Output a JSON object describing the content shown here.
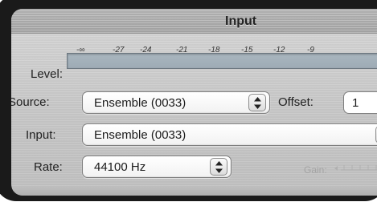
{
  "header": {
    "title": "Input"
  },
  "level": {
    "label": "Level:",
    "ticks": [
      "-∞",
      "-27",
      "-24",
      "-21",
      "-18",
      "-15",
      "-12",
      "-9"
    ]
  },
  "source": {
    "label": "Source:",
    "value": "Ensemble (0033)"
  },
  "offset": {
    "label": "Offset:",
    "value": "1"
  },
  "input": {
    "label": "Input:",
    "value": "Ensemble (0033)"
  },
  "rate": {
    "label": "Rate:",
    "value": "44100 Hz"
  },
  "gain": {
    "label": "Gain:"
  }
}
